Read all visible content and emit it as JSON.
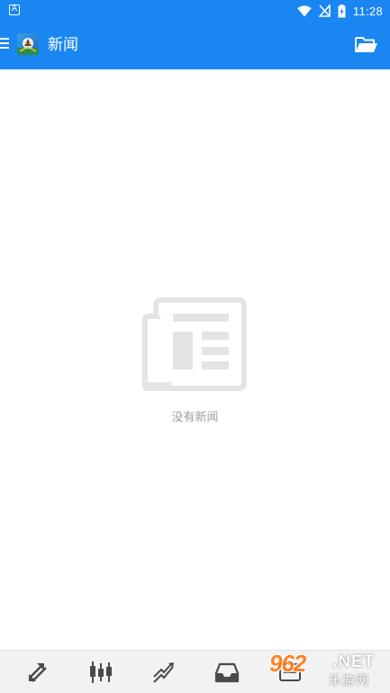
{
  "status_bar": {
    "notification_icon": "A",
    "icons": [
      "wifi-icon",
      "signal-muted-icon",
      "battery-charging-icon"
    ],
    "time": "11:28"
  },
  "app_bar": {
    "title": "新闻",
    "menu_icon": "hamburger-menu-icon",
    "logo_icon": "app-logo-icon",
    "action_icon": "folder-open-icon",
    "color": "#1a86f2"
  },
  "empty_state": {
    "icon": "newspaper-icon",
    "message": "没有新闻"
  },
  "bottom_nav": {
    "tabs": [
      {
        "icon": "trade-arrows-icon"
      },
      {
        "icon": "candlestick-chart-icon"
      },
      {
        "icon": "trend-line-icon"
      },
      {
        "icon": "inbox-icon"
      },
      {
        "icon": "more-icon"
      }
    ]
  },
  "watermark": {
    "number": "962",
    "suffix": ".NET",
    "subtitle": "乐游网"
  }
}
